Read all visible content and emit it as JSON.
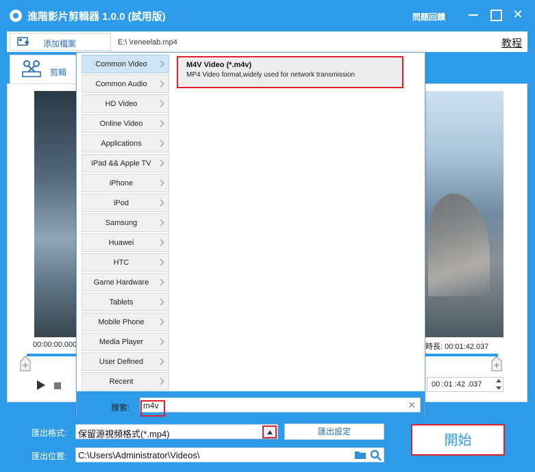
{
  "titlebar": {
    "title": "進階影片剪輯器 1.0.0 (試用版)",
    "help": "問題回饋",
    "close": "✕"
  },
  "toolbar": {
    "add_file": "添加檔案",
    "file_path": "E:\\          \\reneelab.mp4",
    "tutorial": "教程"
  },
  "tabs": {
    "edit": "剪輯"
  },
  "player": {
    "time_start": "00:00:00.000",
    "time_total": "時長: 00:01:42.037",
    "end_time": "00 :01 :42 .037"
  },
  "format_popup": {
    "categories": [
      "Common Video",
      "Common Audio",
      "HD Video",
      "Online Video",
      "Applications",
      "iPad && Apple TV",
      "iPhone",
      "iPod",
      "Samsung",
      "Huawei",
      "HTC",
      "Game Hardware",
      "Tablets",
      "Mobile Phone",
      "Media Player",
      "User Defined",
      "Recent"
    ],
    "selected_category": "Common Video",
    "result": {
      "title": "M4V Video (*.m4v)",
      "description": "MP4 Video format,widely used for network transmission"
    },
    "search_label": "搜索:",
    "search_value": "m4v",
    "clear": "✕"
  },
  "export": {
    "format_label": "匯出格式:",
    "format_value": "保留源視頻格式(*.mp4)",
    "settings": "匯出設定",
    "location_label": "匯出位置:",
    "location_value": "C:\\Users\\Administrator\\Videos\\",
    "start": "開始"
  },
  "colors": {
    "primary": "#2d9be8",
    "highlight": "#e0202c",
    "selected_category": "#cfe5f7"
  }
}
